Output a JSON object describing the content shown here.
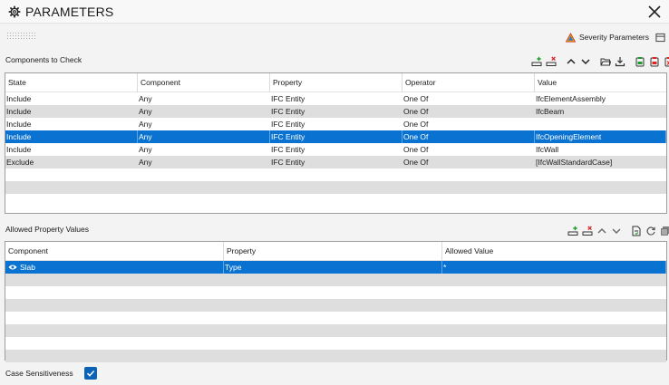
{
  "window": {
    "title": "PARAMETERS"
  },
  "severity": {
    "label": "Severity Parameters"
  },
  "components": {
    "section_label": "Components to Check",
    "columns": [
      "State",
      "Component",
      "Property",
      "Operator",
      "Value"
    ],
    "rows": [
      [
        "Include",
        "Any",
        "IFC Entity",
        "One Of",
        "IfcElementAssembly"
      ],
      [
        "Include",
        "Any",
        "IFC Entity",
        "One Of",
        "IfcBeam"
      ],
      [
        "Include",
        "Any",
        "IFC Entity",
        "One Of",
        ""
      ],
      [
        "Include",
        "Any",
        "IFC Entity",
        "One Of",
        "IfcOpeningElement"
      ],
      [
        "Include",
        "Any",
        "IFC Entity",
        "One Of",
        "IfcWall"
      ],
      [
        "Exclude",
        "Any",
        "IFC Entity",
        "One Of",
        "[IfcWallStandardCase]"
      ]
    ],
    "selected_row": 3
  },
  "allowed": {
    "section_label": "Allowed Property Values",
    "columns": [
      "Component",
      "Property",
      "Allowed Value"
    ],
    "rows": [
      [
        "Slab",
        "Type",
        "*"
      ]
    ],
    "selected_row": 0
  },
  "case_sensitiveness": {
    "label": "Case Sensitiveness",
    "checked": true
  },
  "colors": {
    "selection": "#0a73d2",
    "alt_row": "#dedede",
    "warning": "#f2a400"
  }
}
